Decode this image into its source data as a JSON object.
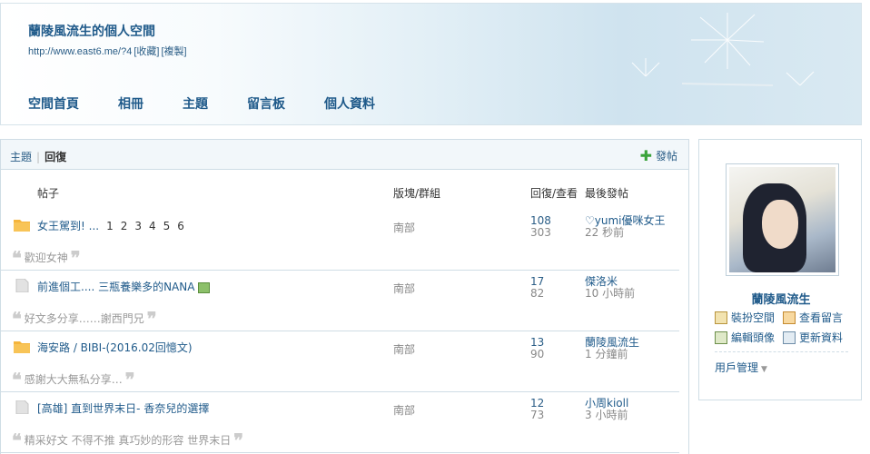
{
  "site": {
    "title": "蘭陵風流生的個人空間",
    "url": "http://www.east6.me/?4",
    "bookmark": "[收藏]",
    "copy": "[複製]"
  },
  "nav": [
    {
      "label": "空間首頁"
    },
    {
      "label": "相冊"
    },
    {
      "label": "主題"
    },
    {
      "label": "留言板"
    },
    {
      "label": "個人資料"
    }
  ],
  "breadcrumb": {
    "topic": "主題",
    "current": "回復"
  },
  "post_button": "發帖",
  "columns": {
    "post": "帖子",
    "forum": "版塊/群組",
    "reply_view": "回復/查看",
    "last_post": "最後發帖"
  },
  "rows": [
    {
      "title": "女王駕到! ...",
      "pages": [
        "1",
        "2",
        "3",
        "4",
        "5",
        "6"
      ],
      "forum": "南部",
      "replies": "108",
      "views": "303",
      "last_user": "♡yumi優咪女王",
      "last_time": "22 秒前",
      "quote": "歡迎女神",
      "folder": "hot"
    },
    {
      "title": "前進個工.... 三瓶養樂多的NANA",
      "pages": [],
      "forum": "南部",
      "replies": "17",
      "views": "82",
      "last_user": "傑洛米",
      "last_time": "10 小時前",
      "quote": "好文多分享……謝西門兄",
      "folder": "normal",
      "has_image": true
    },
    {
      "title": "海安路 / BIBI-(2016.02回憶文)",
      "pages": [],
      "forum": "南部",
      "replies": "13",
      "views": "90",
      "last_user": "蘭陵風流生",
      "last_time": "1 分鐘前",
      "quote": "感謝大大無私分享…",
      "folder": "hot"
    },
    {
      "title": "[高雄] 直到世界末日- 香奈兒的選擇",
      "pages": [],
      "forum": "南部",
      "replies": "12",
      "views": "73",
      "last_user": "小周kioll",
      "last_time": "3 小時前",
      "quote": "精采好文 不得不推 真巧妙的形容 世界末日",
      "folder": "normal"
    }
  ],
  "profile": {
    "name": "蘭陵風流生",
    "links": {
      "decorate": "裝扮空間",
      "view_messages": "查看留言",
      "edit_avatar": "編輯頭像",
      "update_profile": "更新資料"
    },
    "user_mgmt": "用戶管理"
  },
  "colors": {
    "link": "#1f5a8a",
    "border": "#cfdde5",
    "folder_hot": "#f5b53c",
    "folder_normal": "#d9d9d9"
  }
}
